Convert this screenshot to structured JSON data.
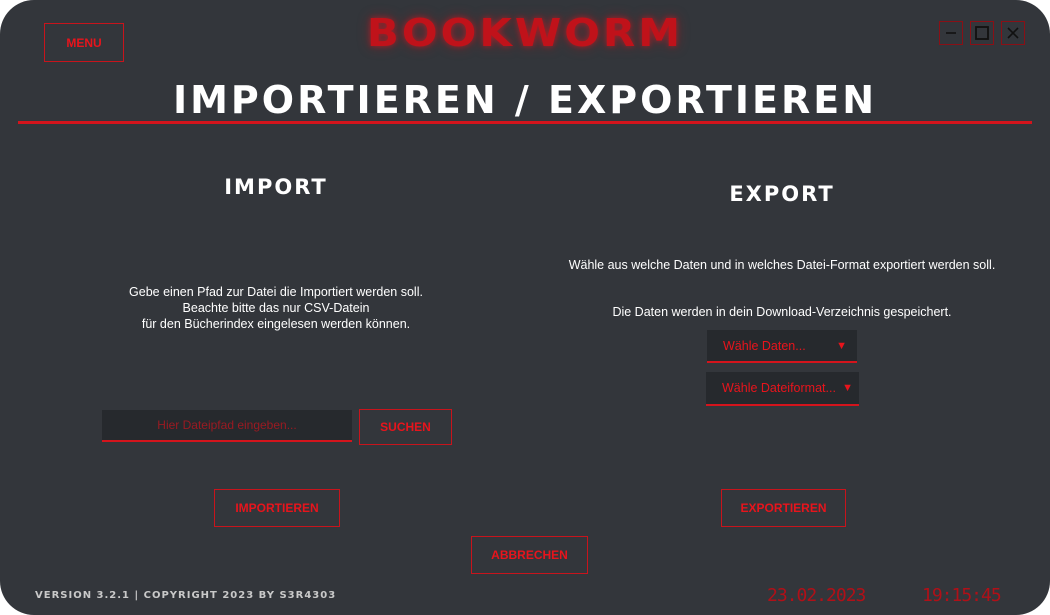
{
  "app": {
    "brand": "BOOKWORM",
    "menu_label": "MENU",
    "window_controls": {
      "minimize_icon": "minimize-icon",
      "maximize_icon": "maximize-icon",
      "close_icon": "close-icon"
    }
  },
  "page": {
    "title": "IMPORTIEREN / EXPORTIEREN"
  },
  "import": {
    "heading": "IMPORT",
    "info_lines": [
      "Gebe einen Pfad zur Datei die Importiert werden soll.",
      "Beachte bitte das nur CSV-Datein",
      "für den Bücherindex eingelesen werden können."
    ],
    "path_input": {
      "value": "",
      "placeholder": "Hier Dateipfad eingeben..."
    },
    "search_label": "SUCHEN",
    "import_label": "IMPORTIEREN"
  },
  "export": {
    "heading": "EXPORT",
    "info_line_1": "Wähle aus welche Daten und in welches Datei-Format exportiert werden soll.",
    "info_line_2": "Die Daten werden in dein Download-Verzeichnis gespeichert.",
    "data_select": {
      "label": "Wähle Daten...",
      "caret": "▼"
    },
    "format_select": {
      "label": "Wähle Dateiformat...",
      "caret": "▼"
    },
    "export_label": "EXPORTIEREN"
  },
  "cancel_label": "ABBRECHEN",
  "footer": {
    "version_text": "VERSION 3.2.1 | COPYRIGHT 2023 BY S3R4303",
    "date": "23.02.2023",
    "time": "19:15:45"
  },
  "colors": {
    "background": "#33363b",
    "accent": "#d4141c",
    "field": "#26292d",
    "text": "#ffffff"
  }
}
